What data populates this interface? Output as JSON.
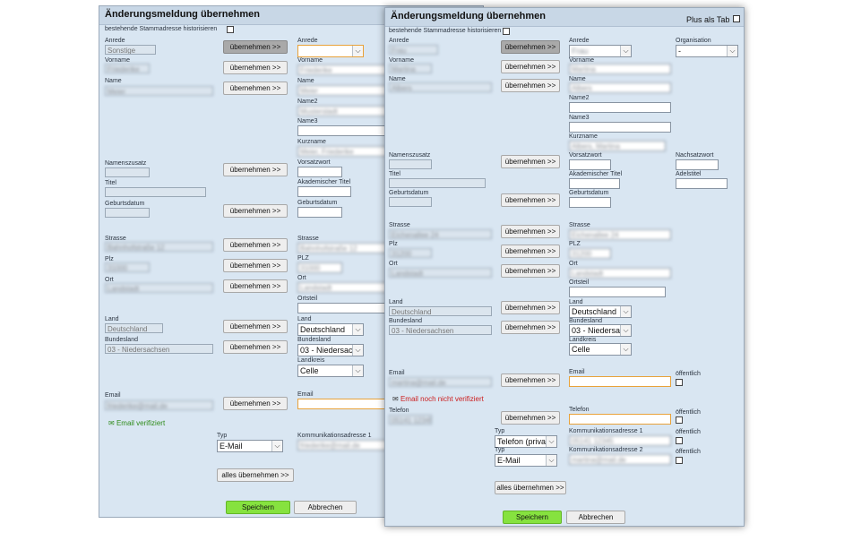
{
  "back": {
    "title": "Änderungsmeldung übernehmen",
    "historize_label": "bestehende Stammadresse historisieren",
    "copy_btn": "übernehmen >>",
    "copy_all_btn": "alles übernehmen >>",
    "save_btn": "Speichern",
    "cancel_btn": "Abbrechen",
    "verified": "Email verifiziert",
    "labels": {
      "anrede": "Anrede",
      "vorname": "Vorname",
      "name": "Name",
      "name2": "Name2",
      "name3": "Name3",
      "kurzname": "Kurzname",
      "namenszusatz": "Namenszusatz",
      "vorsatzwort": "Vorsatzwort",
      "titel": "Titel",
      "akad_titel": "Akademischer Titel",
      "geburtsdatum": "Geburtsdatum",
      "strasse": "Strasse",
      "plz": "Plz",
      "plz_right": "PLZ",
      "ort": "Ort",
      "ortsteil": "Ortsteil",
      "land": "Land",
      "bundesland": "Bundesland",
      "landkreis": "Landkreis",
      "email": "Email",
      "typ": "Typ",
      "komm1": "Kommunikationsadresse 1"
    },
    "values": {
      "anrede": "Sonstige",
      "vorname": "Friederike",
      "name": "Meier",
      "vorname_r": "Friederike",
      "name_r": "Meier",
      "name2_r": "Musterstadt",
      "kurzname_r": "Meier, Friederike",
      "strasse": "Bahnhofstraße 12",
      "plz": "31000",
      "ort": "Landstadt",
      "strasse_r": "Bahnhofstraße 12",
      "plz_r": "31000",
      "ort_r": "Landstadt",
      "land": "Deutschland",
      "bundesland": "03 - Niedersachsen",
      "land_r": "Deutschland",
      "bundesland_r": "03 - Niedersachsen",
      "landkreis_r": "Celle",
      "email": "friederike@mail.de",
      "typ": "E-Mail",
      "komm1": "friederike@mail.de"
    }
  },
  "front": {
    "title": "Änderungsmeldung übernehmen",
    "plus_tab": "Plus als Tab",
    "historize_label": "bestehende Stammadresse historisieren",
    "copy_btn": "übernehmen >>",
    "copy_all_btn": "alles übernehmen >>",
    "save_btn": "Speichern",
    "cancel_btn": "Abbrechen",
    "not_verified": "Email noch nicht verifiziert",
    "public": "öffentlich",
    "labels": {
      "anrede": "Anrede",
      "organisation": "Organisation",
      "vorname": "Vorname",
      "name": "Name",
      "name2": "Name2",
      "name3": "Name3",
      "kurzname": "Kurzname",
      "namenszusatz": "Namenszusatz",
      "vorsatzwort": "Vorsatzwort",
      "nachsatzwort": "Nachsatzwort",
      "titel": "Titel",
      "akad_titel": "Akademischer Titel",
      "adelstitel": "Adelstitel",
      "geburtsdatum": "Geburtsdatum",
      "strasse": "Strasse",
      "plz": "Plz",
      "plz_right": "PLZ",
      "ort": "Ort",
      "ortsteil": "Ortsteil",
      "land": "Land",
      "bundesland": "Bundesland",
      "landkreis": "Landkreis",
      "email": "Email",
      "telefon": "Telefon",
      "typ": "Typ",
      "komm1": "Kommunikationsadresse 1",
      "komm2": "Kommunikationsadresse 2"
    },
    "values": {
      "anrede": "Frau",
      "anrede_r": "Frau",
      "organisation": "-",
      "vorname": "Martina",
      "name": "Albers",
      "vorname_r": "Martina",
      "name_r": "Albers",
      "kurzname_r": "Albers, Martina",
      "strasse": "Eichenallee 24",
      "plz": "31200",
      "ort": "Landstadt",
      "strasse_r": "Eichenallee 24",
      "plz_r": "31200",
      "ort_r": "Landstadt",
      "land": "Deutschland",
      "bundesland": "03 - Niedersachsen",
      "land_r": "Deutschland",
      "bundesland_r": "03 - Niedersachsen",
      "landkreis_r": "Celle",
      "email": "martina@mail.de",
      "telefon": "05141 12345",
      "typ1": "Telefon (privat)",
      "typ2": "E-Mail",
      "komm1": "05141 12345",
      "komm2": "martina@mail.de"
    }
  },
  "colors": {
    "panel": "#d9e6f2",
    "header": "#c8d7e6",
    "save": "#86e23f",
    "verified": "#2e8b1a",
    "not_verified": "#cc2020",
    "highlight": "#e8a23a"
  },
  "icons": {
    "verified": "envelope-check-icon",
    "not_verified": "envelope-alert-icon",
    "dropdown": "chevron-down-icon"
  }
}
